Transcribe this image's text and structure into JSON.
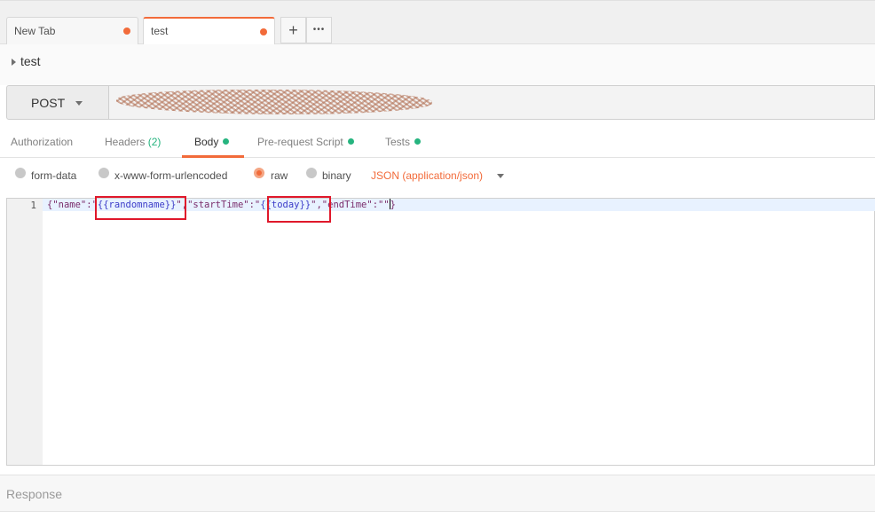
{
  "tabs": [
    {
      "label": "New Tab",
      "unsaved": true,
      "active": false
    },
    {
      "label": "test",
      "unsaved": true,
      "active": true
    }
  ],
  "tab_actions": {
    "add": "+",
    "more": "•••"
  },
  "request": {
    "name": "test",
    "method": "POST",
    "url": ""
  },
  "subtabs": {
    "authorization": "Authorization",
    "headers": "Headers",
    "headers_count": "(2)",
    "body": "Body",
    "prerequest": "Pre-request Script",
    "tests": "Tests"
  },
  "body_types": {
    "form_data": "form-data",
    "urlencoded": "x-www-form-urlencoded",
    "raw": "raw",
    "binary": "binary",
    "selected": "raw",
    "content_type": "JSON (application/json)"
  },
  "editor": {
    "line_number": "1",
    "code": {
      "p1": "{\"name\":\"",
      "v1": "{{randomname}}",
      "p2": "\",\"startTime\":\"",
      "v2": "{{today}}",
      "p3": "\",\"endTime\":\"\"",
      "p4": "}"
    }
  },
  "response": {
    "label": "Response"
  },
  "colors": {
    "accent": "#f26b3a",
    "green": "#26b47f",
    "highlight_box": "#e0182b"
  }
}
